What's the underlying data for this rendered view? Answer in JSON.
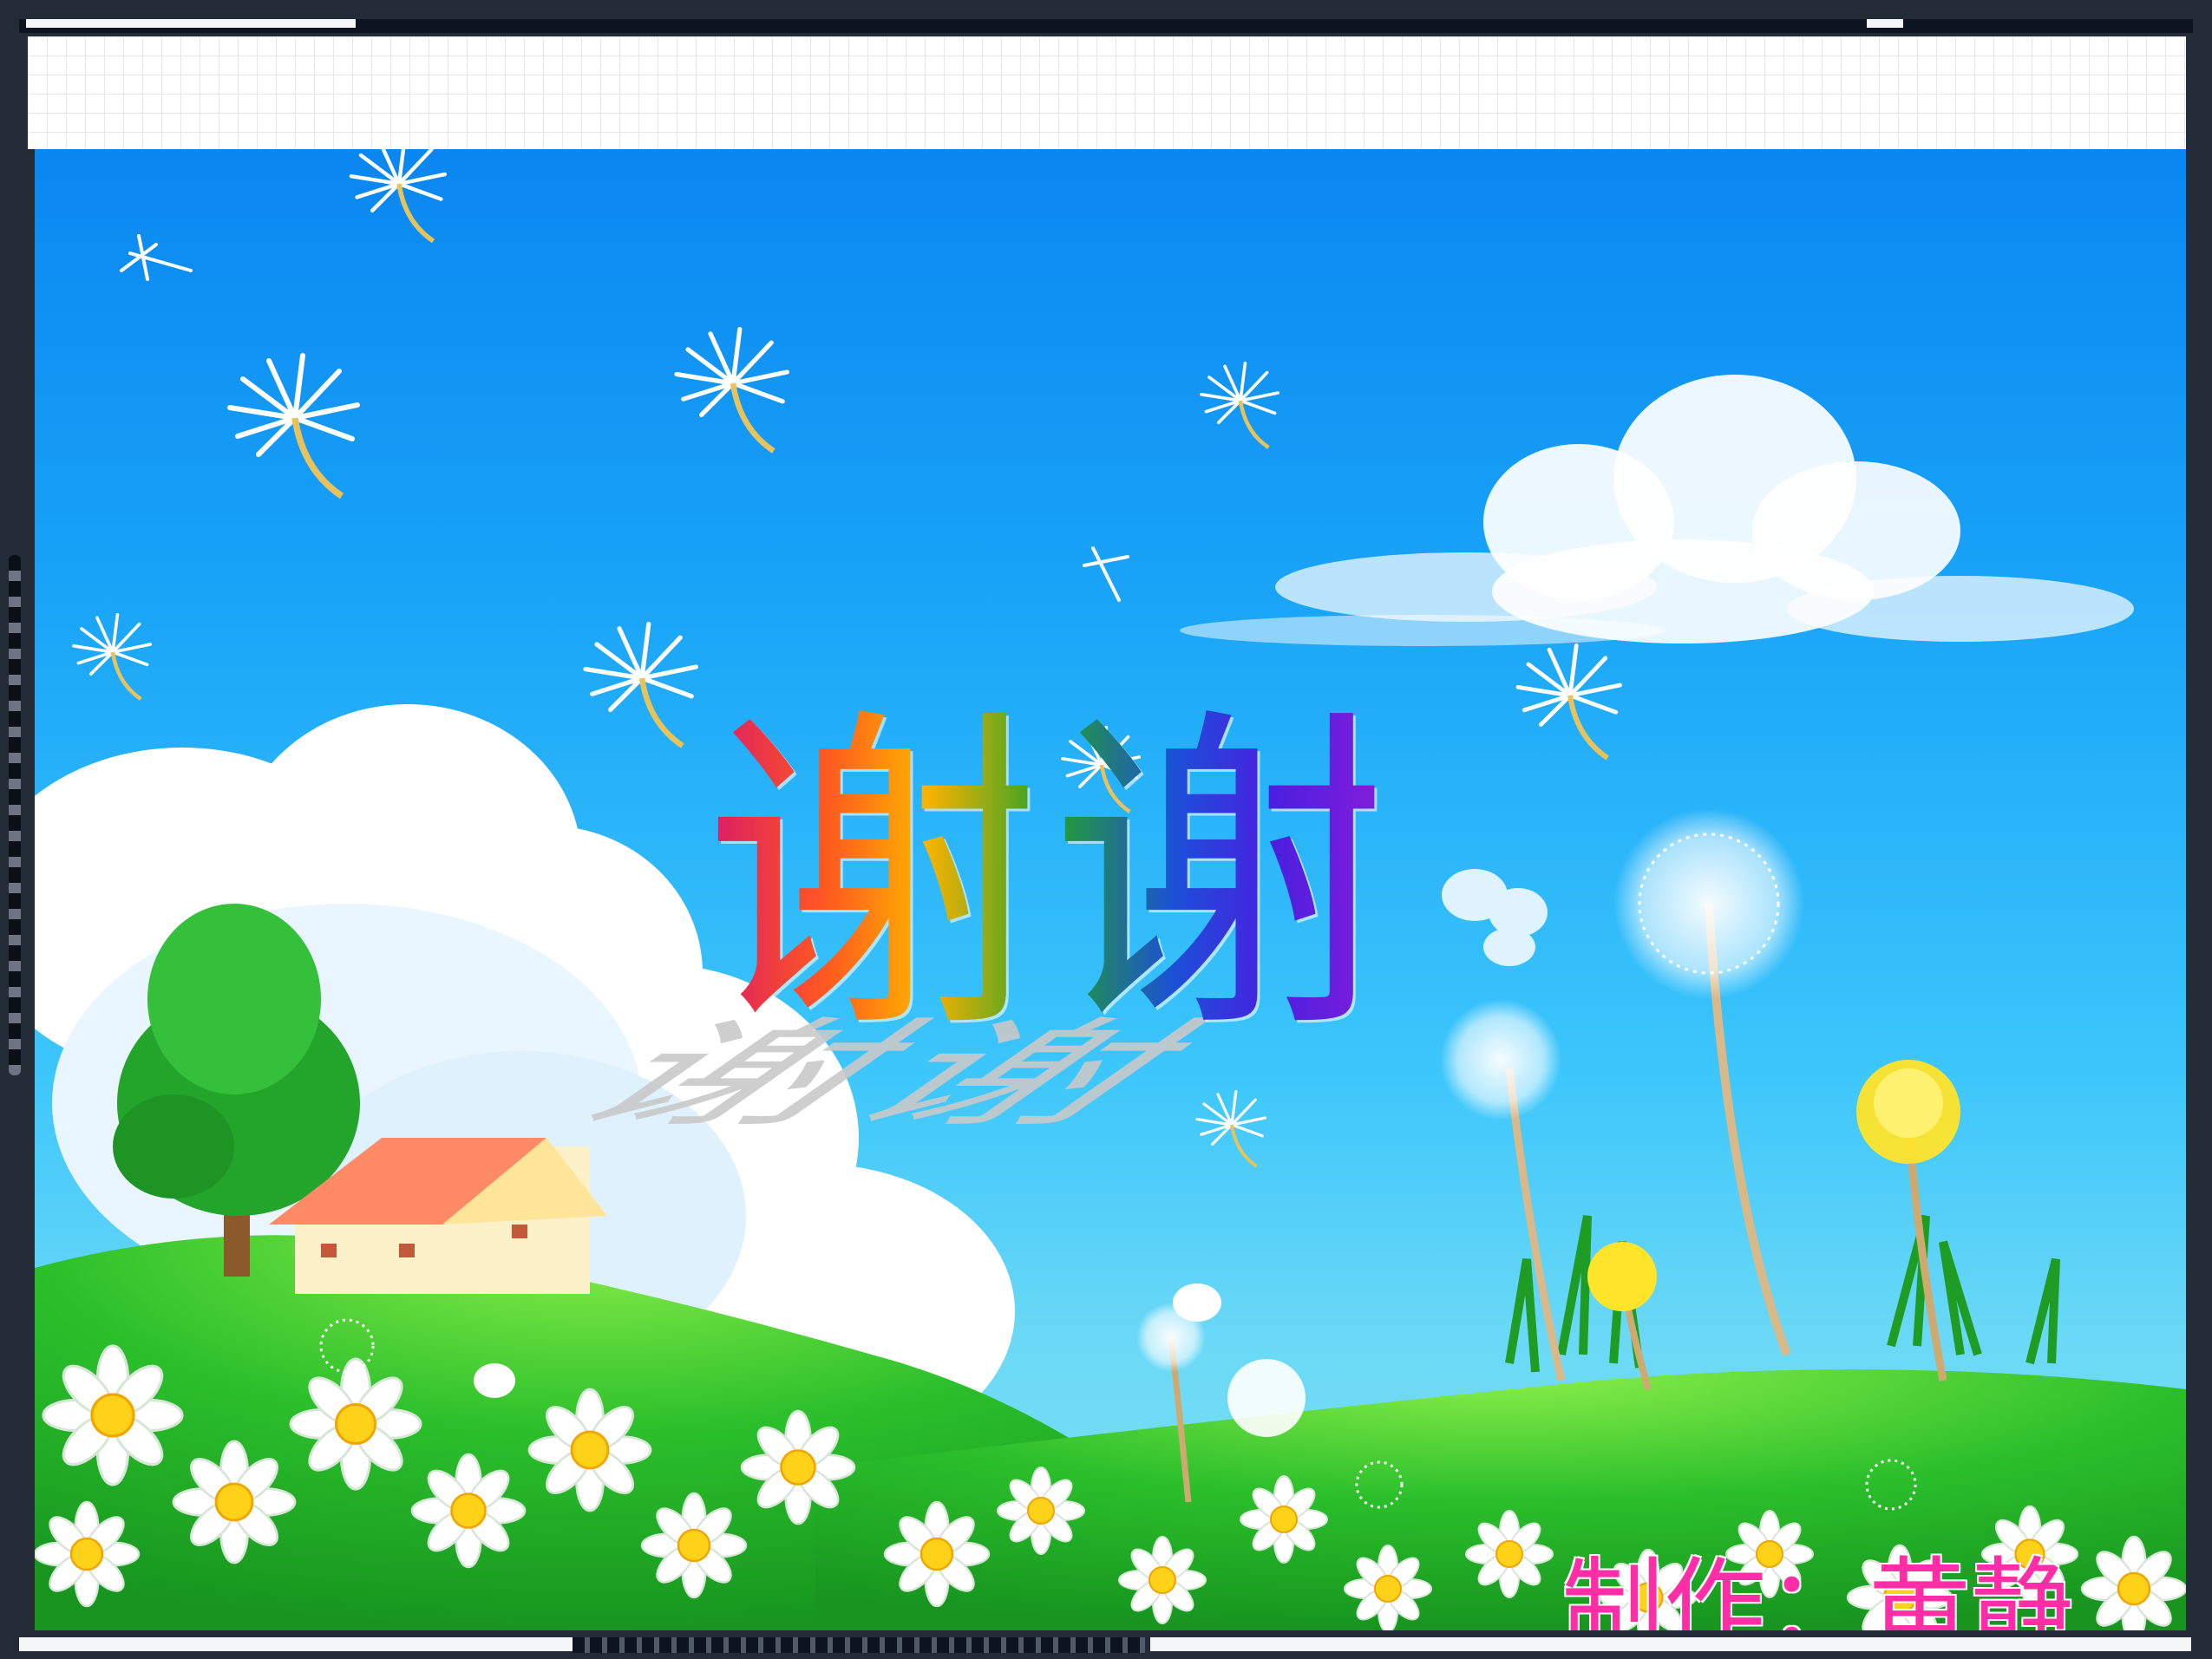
{
  "slide": {
    "title": "谢谢",
    "credit_label": "制作：",
    "credit_name": "黄静"
  },
  "colors": {
    "title_gradient": [
      "#d9186b",
      "#ff5a1f",
      "#ffb300",
      "#24a22a",
      "#1c4fd8",
      "#8b1ed8"
    ],
    "credit_color": "#ff2ea6",
    "sky_top": "#0a86f0",
    "sky_bottom": "#7fe3f0",
    "grass": "#2bbf2b"
  },
  "icons": [
    "dandelion-seed-icon",
    "cloud-icon",
    "tree-icon",
    "house-icon",
    "daisy-flower-icon",
    "dandelion-flower-icon",
    "butterfly-icon"
  ]
}
